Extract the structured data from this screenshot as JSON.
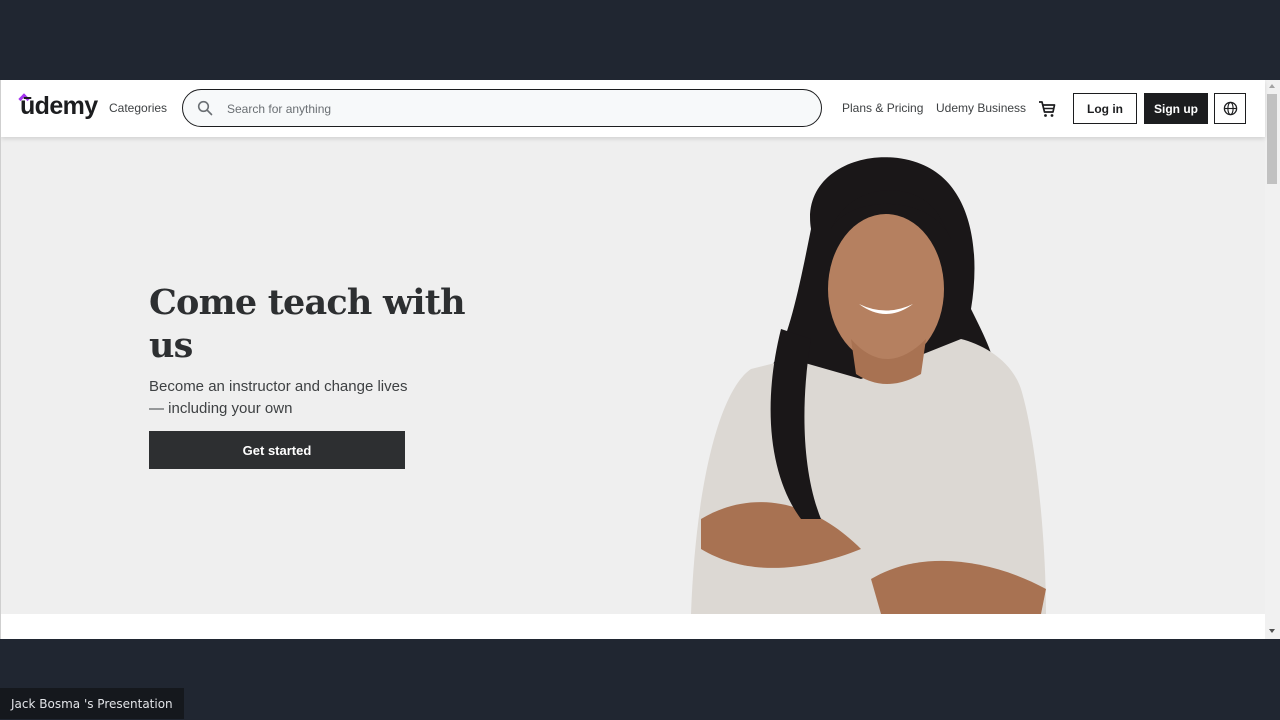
{
  "header": {
    "logo": "ūdemy",
    "categories_label": "Categories",
    "search": {
      "placeholder": "Search for anything",
      "value": ""
    },
    "nav_links": [
      "Plans & Pricing",
      "Udemy Business"
    ],
    "login_label": "Log in",
    "signup_label": "Sign up",
    "icons": {
      "search": "search-icon",
      "cart": "cart-icon",
      "language": "globe-icon"
    }
  },
  "hero": {
    "title": "Come teach with us",
    "subtitle": "Become an instructor and change lives — including your own",
    "cta_label": "Get started",
    "image": "smiling-instructor-photo"
  },
  "presentation": {
    "label": "Jack Bosma 's Presentation"
  },
  "colors": {
    "brand_accent": "#a435f0",
    "primary_dark": "#1c1d1f",
    "hero_bg": "#efefef",
    "frame_bg": "#202631"
  }
}
